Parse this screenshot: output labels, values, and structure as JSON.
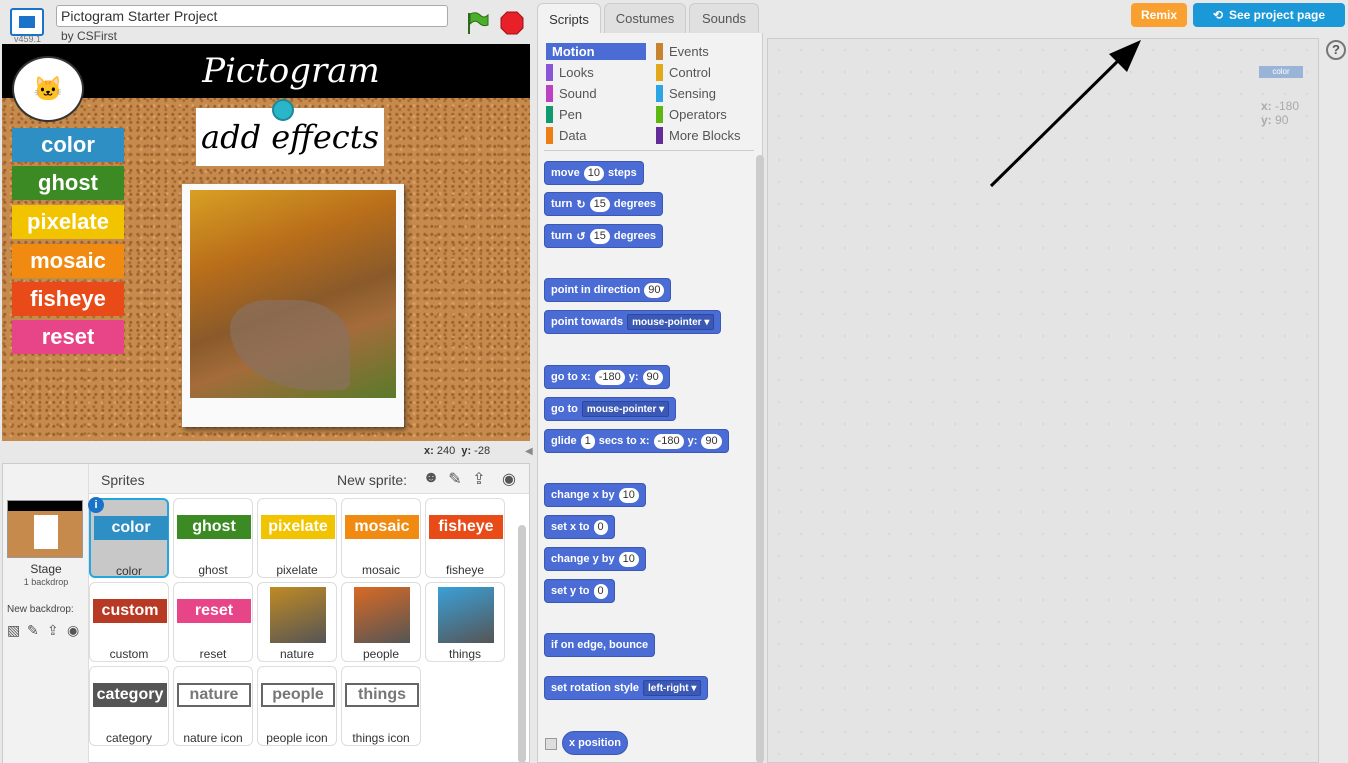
{
  "header": {
    "version": "v459.1",
    "project_title": "Pictogram Starter Project",
    "author": "by CSFirst"
  },
  "stage": {
    "title": "Pictogram",
    "effects_card": "add effects",
    "buttons": [
      {
        "label": "color",
        "color": "#2e8fc4"
      },
      {
        "label": "ghost",
        "color": "#3c8a24"
      },
      {
        "label": "pixelate",
        "color": "#f2c400"
      },
      {
        "label": "mosaic",
        "color": "#f08a10"
      },
      {
        "label": "fisheye",
        "color": "#e84a18"
      },
      {
        "label": "reset",
        "color": "#e84488"
      }
    ],
    "mouse_x_label": "x:",
    "mouse_x": "240",
    "mouse_y_label": "y:",
    "mouse_y": "-28"
  },
  "sprite_pane": {
    "title": "Sprites",
    "new_sprite_label": "New sprite:",
    "new_sprite_icons": [
      "character-icon",
      "paintbrush-icon",
      "upload-icon",
      "camera-icon"
    ],
    "stage_name": "Stage",
    "stage_backdrops": "1 backdrop",
    "new_backdrop_label": "New backdrop:",
    "sprites": [
      {
        "name": "color",
        "costume": "color",
        "kind": "label",
        "color": "#2e8fc4"
      },
      {
        "name": "ghost",
        "costume": "ghost",
        "kind": "label",
        "color": "#3c8a24"
      },
      {
        "name": "pixelate",
        "costume": "pixelate",
        "kind": "label",
        "color": "#f2c400"
      },
      {
        "name": "mosaic",
        "costume": "mosaic",
        "kind": "label",
        "color": "#f08a10"
      },
      {
        "name": "fisheye",
        "costume": "fisheye",
        "kind": "label",
        "color": "#e84a18"
      },
      {
        "name": "custom",
        "costume": "custom",
        "kind": "label",
        "color": "#b83a24"
      },
      {
        "name": "reset",
        "costume": "reset",
        "kind": "label",
        "color": "#e84488"
      },
      {
        "name": "nature",
        "kind": "image",
        "color": "#c08a24"
      },
      {
        "name": "people",
        "kind": "image",
        "color": "#d86a24"
      },
      {
        "name": "things",
        "kind": "image",
        "color": "#3aa0d8"
      },
      {
        "name": "category",
        "costume": "category",
        "kind": "label",
        "color": "#555555"
      },
      {
        "name": "nature icon",
        "costume": "nature",
        "kind": "outline"
      },
      {
        "name": "people icon",
        "costume": "people",
        "kind": "outline"
      },
      {
        "name": "things icon",
        "costume": "things",
        "kind": "outline"
      }
    ]
  },
  "tabs": [
    "Scripts",
    "Costumes",
    "Sounds"
  ],
  "categories": {
    "left": [
      {
        "label": "Motion",
        "color": "#4a6cd4",
        "active": true
      },
      {
        "label": "Looks",
        "color": "#8a55d7"
      },
      {
        "label": "Sound",
        "color": "#bb42c3"
      },
      {
        "label": "Pen",
        "color": "#0e9a6c"
      },
      {
        "label": "Data",
        "color": "#ee7d16"
      }
    ],
    "right": [
      {
        "label": "Events",
        "color": "#c88330"
      },
      {
        "label": "Control",
        "color": "#e1a91a"
      },
      {
        "label": "Sensing",
        "color": "#2ca5e2"
      },
      {
        "label": "Operators",
        "color": "#5cb712"
      },
      {
        "label": "More Blocks",
        "color": "#632d99"
      }
    ]
  },
  "blocks": {
    "move": {
      "pre": "move",
      "val": "10",
      "post": "steps"
    },
    "turn_cw": {
      "pre": "turn",
      "val": "15",
      "post": "degrees"
    },
    "turn_ccw": {
      "pre": "turn",
      "val": "15",
      "post": "degrees"
    },
    "point_dir": {
      "pre": "point in direction",
      "val": "90"
    },
    "point_towards": {
      "pre": "point towards",
      "dd": "mouse-pointer"
    },
    "goto_xy": {
      "pre": "go to x:",
      "x": "-180",
      "mid": "y:",
      "y": "90"
    },
    "goto": {
      "pre": "go to",
      "dd": "mouse-pointer"
    },
    "glide": {
      "pre": "glide",
      "secs": "1",
      "mid1": "secs to x:",
      "x": "-180",
      "mid2": "y:",
      "y": "90"
    },
    "change_x": {
      "pre": "change x by",
      "val": "10"
    },
    "set_x": {
      "pre": "set x to",
      "val": "0"
    },
    "change_y": {
      "pre": "change y by",
      "val": "10"
    },
    "set_y": {
      "pre": "set y to",
      "val": "0"
    },
    "bounce": {
      "pre": "if on edge, bounce"
    },
    "rotation": {
      "pre": "set rotation style",
      "dd": "left-right"
    },
    "x_position": {
      "pre": "x position"
    }
  },
  "script_area": {
    "sprite_label": "color",
    "x_label": "x:",
    "x": "-180",
    "y_label": "y:",
    "y": "90"
  },
  "top_right": {
    "remix": "Remix",
    "see_project": "See project page"
  }
}
